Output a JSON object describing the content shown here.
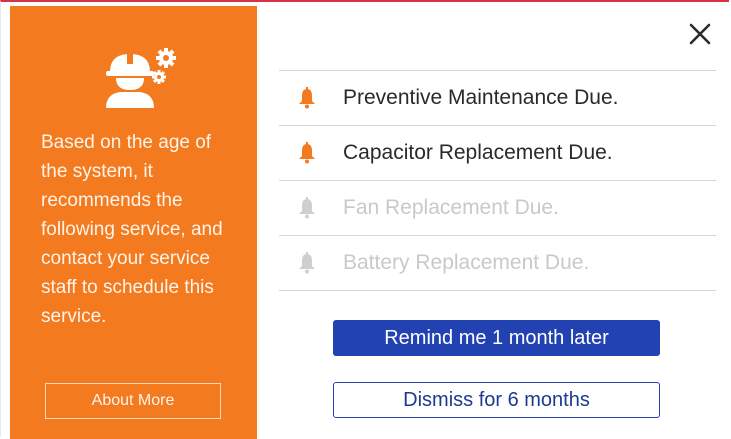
{
  "sidebar": {
    "icon": "worker-gears-icon",
    "message": "Based on the age of the system, it recommends the following service, and contact your service staff to schedule this service.",
    "about_label": "About More"
  },
  "dialog": {
    "close_icon": "close-icon",
    "items": [
      {
        "label": "Preventive Maintenance Due.",
        "icon": "bell-icon",
        "state": "active"
      },
      {
        "label": "Capacitor  Replacement Due.",
        "icon": "bell-icon",
        "state": "active"
      },
      {
        "label": "Fan Replacement Due.",
        "icon": "bell-icon",
        "state": "inactive"
      },
      {
        "label": "Battery Replacement Due.",
        "icon": "bell-icon",
        "state": "inactive"
      }
    ],
    "remind_label": "Remind me 1 month later",
    "dismiss_label": "Dismiss for 6 months"
  },
  "colors": {
    "sidebar_bg": "#f47a20",
    "primary": "#2242b2",
    "bell_active": "#f47a20",
    "bell_inactive": "#cfcfcf",
    "top_border": "#d8324a"
  }
}
